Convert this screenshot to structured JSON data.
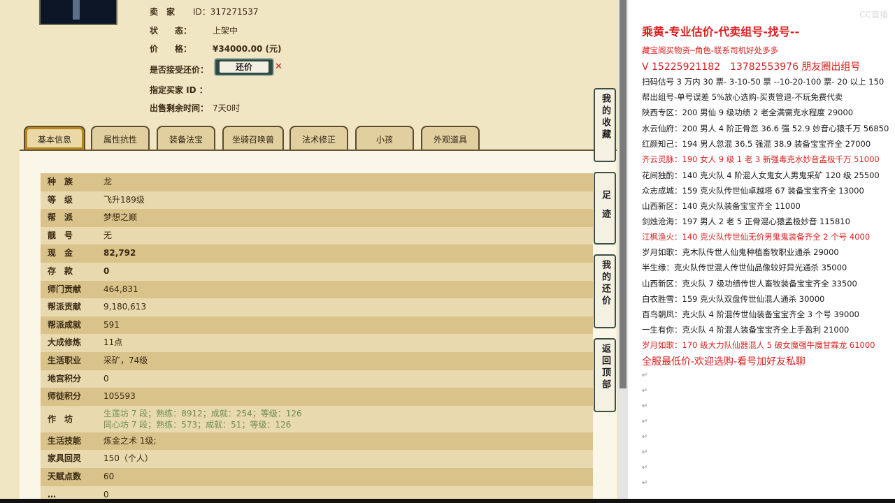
{
  "seller": {
    "rows": [
      {
        "label": "卖　家",
        "value": "ID：317271537"
      },
      {
        "label": "状　　态：",
        "value": "上架中"
      },
      {
        "label": "价　　格：",
        "value": "¥34000.00 (元)"
      },
      {
        "label": "是否接受还价：",
        "value": ""
      },
      {
        "label": "指定买家 ID ：",
        "value": ""
      },
      {
        "label": "出售剩余时间：",
        "value": "7天0时"
      }
    ],
    "bargain_label": "还价"
  },
  "tabs": [
    "基本信息",
    "属性抗性",
    "装备法宝",
    "坐骑召唤兽",
    "法术修正",
    "小孩",
    "外观道具"
  ],
  "attrs": [
    {
      "k": "种　族",
      "v": "龙"
    },
    {
      "k": "等　级",
      "v": "飞升189级"
    },
    {
      "k": "帮　派",
      "v": "梦想之巅"
    },
    {
      "k": "靓　号",
      "v": "无"
    },
    {
      "k": "现　金",
      "v": "82,792"
    },
    {
      "k": "存　款",
      "v": "0"
    },
    {
      "k": "师门贡献",
      "v": "464,831"
    },
    {
      "k": "帮派贡献",
      "v": "9,180,613"
    },
    {
      "k": "帮派成就",
      "v": "591"
    },
    {
      "k": "大成修炼",
      "v": "11点"
    },
    {
      "k": "生活职业",
      "v": "采矿，74级"
    },
    {
      "k": "地宫积分",
      "v": "0"
    },
    {
      "k": "师徒积分",
      "v": "105593"
    },
    {
      "k": "作　坊",
      "v1": "生莲坊 7 段；熟练：8912；成就：254；等级：126",
      "v2": "同心坊 7 段；熟练：573；成就：51；等级：126"
    },
    {
      "k": "生活技能",
      "v": "炼金之术 1级;"
    },
    {
      "k": "家具回灵",
      "v": "150（个人）"
    },
    {
      "k": "天赋点数",
      "v": "60"
    },
    {
      "k": "…",
      "v": "0"
    }
  ],
  "side_buttons": [
    "我的收藏",
    "足迹",
    "我的还价",
    "返回顶部"
  ],
  "right": {
    "logo": "CC直播",
    "title": "乘黄-专业估价-代卖组号-找号--",
    "lines": [
      {
        "t": "藏宝阁买物资─角色-联系司机好处多多",
        "c": "red"
      },
      {
        "t": "V 15225921182　13782553976 朋友圈出组号",
        "c": "red",
        "big": true
      },
      {
        "t": "扫码估号 3 万内 30 票- 3-10-50 票 --10-20-100 票- 20 以上 150",
        "c": "black"
      },
      {
        "t": "帮出组号-单号误差 5%放心选购-买贵管退-不玩免费代卖",
        "c": "black"
      },
      {
        "t": "陕西专区：200 男仙 9 级功绩 2 老全满需克水程度 29000",
        "c": "black"
      },
      {
        "t": "水云仙府：200 男人 4 阶正骨忽 36.6 强 52.9 妙音心猿千万 56850",
        "c": "black"
      },
      {
        "t": "红颜知己：194 男人忽混 36.5 强混 38.9 装备宝宝齐全 27000",
        "c": "black"
      },
      {
        "t": "齐云灵脉：190 女人 9 级 1 老 3 新强毒克水妙音孟极千万 51000",
        "c": "red"
      },
      {
        "t": "花间独酌：140 克火队 4 阶混人女鬼女人男鬼采矿 120 级 25500",
        "c": "black"
      },
      {
        "t": "众志成城：159 克火队传世仙卓越塔 67 装备宝宝齐全 13000",
        "c": "black"
      },
      {
        "t": "山西新区：140 克火队装备宝宝齐全 11000",
        "c": "black"
      },
      {
        "t": "剑烛沧海：197 男人 2 老 5 正骨混心猿孟极妙音 115810",
        "c": "black"
      },
      {
        "t": "江枫渔火：140 克火队传世仙无价男鬼鬼装备齐全 2 个号 4000",
        "c": "red"
      },
      {
        "t": "岁月如歌：克木队传世人仙鬼种植畜牧职业通杀 29000",
        "c": "black"
      },
      {
        "t": "半生缘：克火队传世混人传世仙品像较好异光通杀 35000",
        "c": "black"
      },
      {
        "t": "山西新区：克火队 7 级功绩传世人畜牧装备宝宝齐全 33500",
        "c": "black"
      },
      {
        "t": "白衣胜雪：159 克火队双盘传世仙混人通杀 30000",
        "c": "black"
      },
      {
        "t": "百鸟朝凤：克火队 4 阶混传世仙装备宝宝齐全 3 个号 39000",
        "c": "black"
      },
      {
        "t": "一生有你：克火队 4 阶混人装备宝宝齐全上手盈利 21000",
        "c": "black"
      },
      {
        "t": "岁月如歌：170 级大力队仙器混人 5 破女魔强牛魔甘霖龙 61000",
        "c": "red"
      },
      {
        "t": "全服最低价-欢迎选购-看号加好友私聊",
        "c": "red",
        "big": true
      }
    ],
    "para_mark": "↵"
  }
}
